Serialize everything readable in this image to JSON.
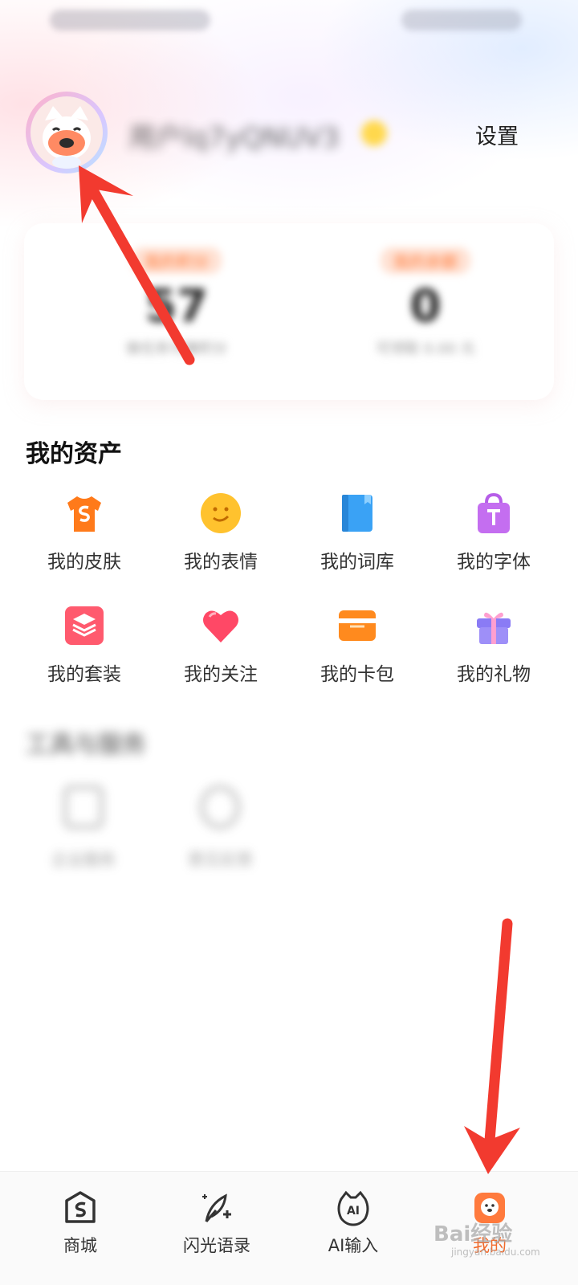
{
  "header": {
    "username": "用户lq7yQNUV3",
    "settings_label": "设置"
  },
  "stats": [
    {
      "tag": "我的积分",
      "value": "57",
      "desc": "做任务可赚积分"
    },
    {
      "tag": "我的余额",
      "value": "0",
      "desc": "可领取 0.00 元"
    }
  ],
  "assets": {
    "title": "我的资产",
    "items": [
      {
        "label": "我的皮肤",
        "icon": "tshirt-icon"
      },
      {
        "label": "我的表情",
        "icon": "smiley-icon"
      },
      {
        "label": "我的词库",
        "icon": "book-icon"
      },
      {
        "label": "我的字体",
        "icon": "font-bag-icon"
      },
      {
        "label": "我的套装",
        "icon": "layers-icon"
      },
      {
        "label": "我的关注",
        "icon": "heart-icon"
      },
      {
        "label": "我的卡包",
        "icon": "card-icon"
      },
      {
        "label": "我的礼物",
        "icon": "gift-icon"
      }
    ]
  },
  "tools": {
    "title": "工具与服务",
    "items": [
      {
        "label": "企业服务",
        "icon": "document-icon"
      },
      {
        "label": "意见反馈",
        "icon": "feedback-icon"
      }
    ]
  },
  "bottom_nav": [
    {
      "label": "商城",
      "icon": "store-icon",
      "active": false
    },
    {
      "label": "闪光语录",
      "icon": "quill-icon",
      "active": false
    },
    {
      "label": "AI输入",
      "icon": "ai-icon",
      "active": false
    },
    {
      "label": "我的",
      "icon": "dog-face-icon",
      "active": true
    }
  ],
  "watermark": {
    "text": "Bai经验",
    "sub": "jingyan.baidu.com"
  },
  "colors": {
    "accent": "#f26a2b",
    "annotation": "#f23a2f"
  }
}
